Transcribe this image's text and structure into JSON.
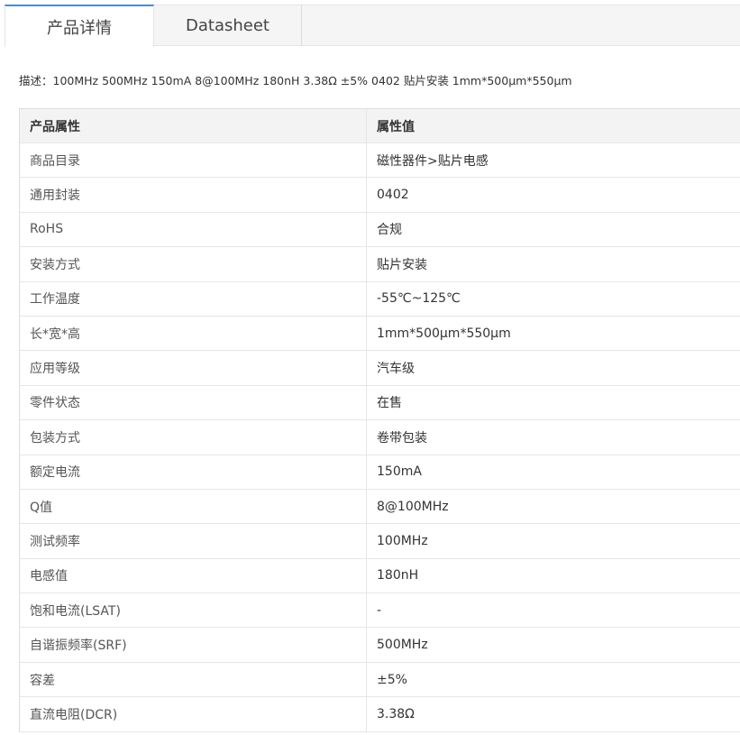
{
  "tabs": [
    {
      "label": "产品详情",
      "active": true
    },
    {
      "label": "Datasheet",
      "active": false
    }
  ],
  "description": "描述：100MHz 500MHz 150mA 8@100MHz 180nH 3.38Ω ±5% 0402 贴片安装 1mm*500μm*550μm",
  "table": {
    "headers": [
      "产品属性",
      "属性值"
    ],
    "rows": [
      [
        "商品目录",
        "磁性器件>贴片电感"
      ],
      [
        "通用封装",
        "0402"
      ],
      [
        "RoHS",
        "合规"
      ],
      [
        "安装方式",
        "贴片安装"
      ],
      [
        "工作温度",
        "-55℃~125℃"
      ],
      [
        "长*宽*高",
        "1mm*500μm*550μm"
      ],
      [
        "应用等级",
        "汽车级"
      ],
      [
        "零件状态",
        "在售"
      ],
      [
        "包装方式",
        "卷带包装"
      ],
      [
        "额定电流",
        "150mA"
      ],
      [
        "Q值",
        "8@100MHz"
      ],
      [
        "测试频率",
        "100MHz"
      ],
      [
        "电感值",
        "180nH"
      ],
      [
        "饱和电流(LSAT)",
        "-"
      ],
      [
        "自谐振频率(SRF)",
        "500MHz"
      ],
      [
        "容差",
        "±5%"
      ],
      [
        "直流电阻(DCR)",
        "3.38Ω"
      ]
    ]
  },
  "colors": {
    "active_tab_accent": "#3a8ee6",
    "tabbar_bg": "#f5f5f5",
    "header_bg": "#f3f3f3"
  }
}
